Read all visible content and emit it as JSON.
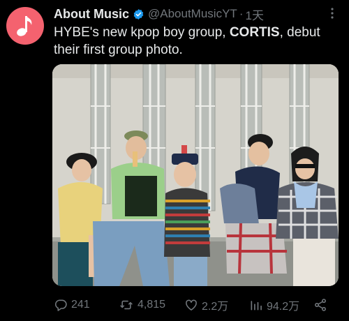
{
  "tweet": {
    "author_name": "About Music",
    "handle": "@AboutMusicYT",
    "separator": "·",
    "time": "1天",
    "text_before": "HYBE's new kpop boy group, ",
    "text_bold": "CORTIS",
    "text_after": ", debut their first group photo."
  },
  "icons": {
    "avatar": "music-note-icon",
    "verified": "verified-badge-icon",
    "more": "more-icon",
    "reply": "reply-icon",
    "retweet": "retweet-icon",
    "like": "heart-icon",
    "views": "views-icon",
    "share": "share-icon"
  },
  "actions": {
    "replies": "241",
    "retweets": "4,815",
    "likes": "2.2万",
    "views": "94.2万"
  },
  "colors": {
    "background": "#000000",
    "avatar_bg": "#f4626f",
    "verified": "#1d9bf0",
    "muted_text": "#71767b",
    "main_text": "#e7e9ea"
  }
}
